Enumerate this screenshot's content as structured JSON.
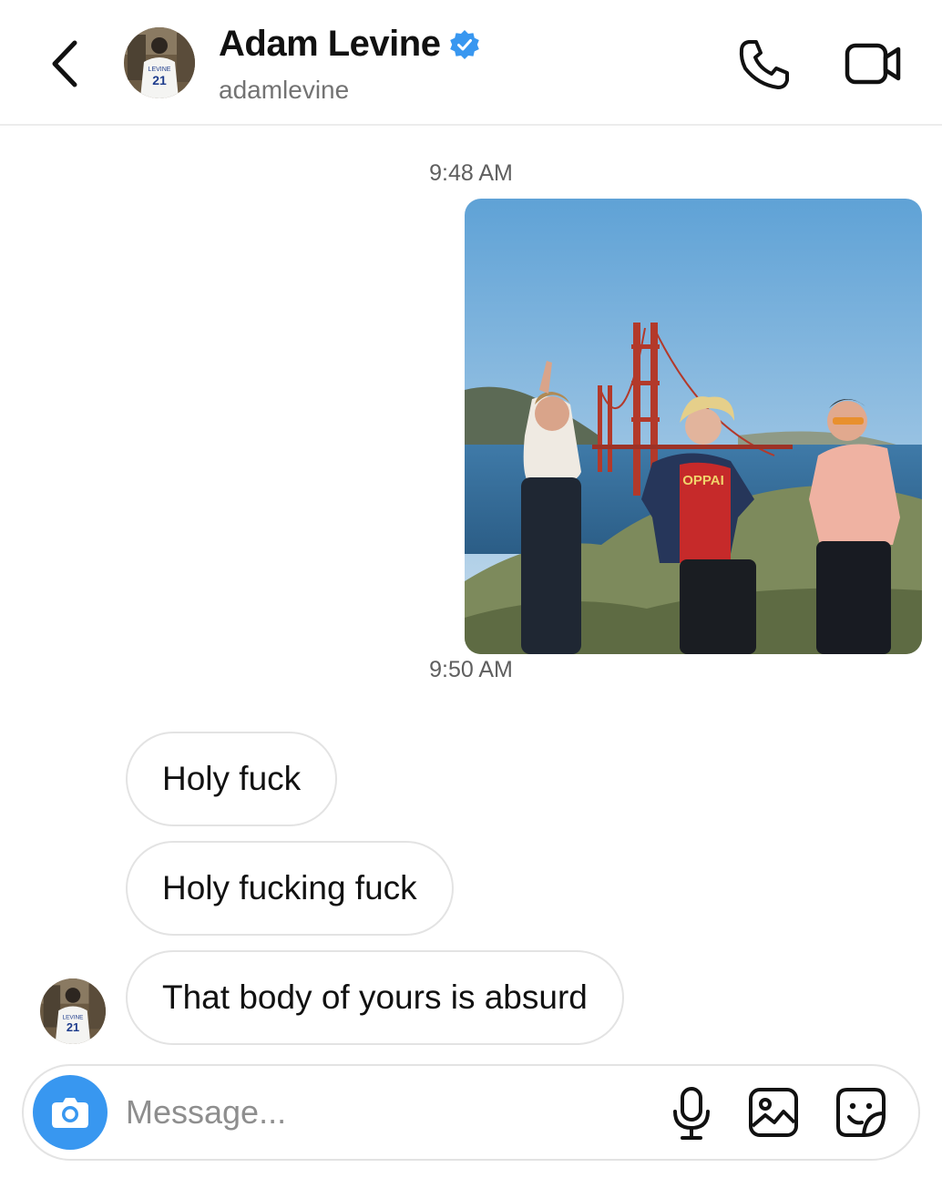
{
  "header": {
    "name": "Adam Levine",
    "handle": "adamlevine",
    "verified": true,
    "icons": {
      "back": "chevron-left-icon",
      "verified": "verified-badge-icon",
      "call": "phone-icon",
      "video": "video-camera-icon"
    }
  },
  "thread": {
    "timestamp_1": "9:48 AM",
    "timestamp_2": "9:50 AM",
    "messages": [
      {
        "text": "Holy fuck"
      },
      {
        "text": "Holy fucking fuck"
      },
      {
        "text": "That body of yours is absurd"
      }
    ]
  },
  "composer": {
    "placeholder": "Message...",
    "icons": {
      "camera": "camera-icon",
      "mic": "microphone-icon",
      "gallery": "image-gallery-icon",
      "sticker": "sticker-icon"
    }
  },
  "colors": {
    "accent": "#3897f0",
    "verified": "#3897f0",
    "bubble_border": "#e3e3e3",
    "secondary_text": "#737373"
  }
}
